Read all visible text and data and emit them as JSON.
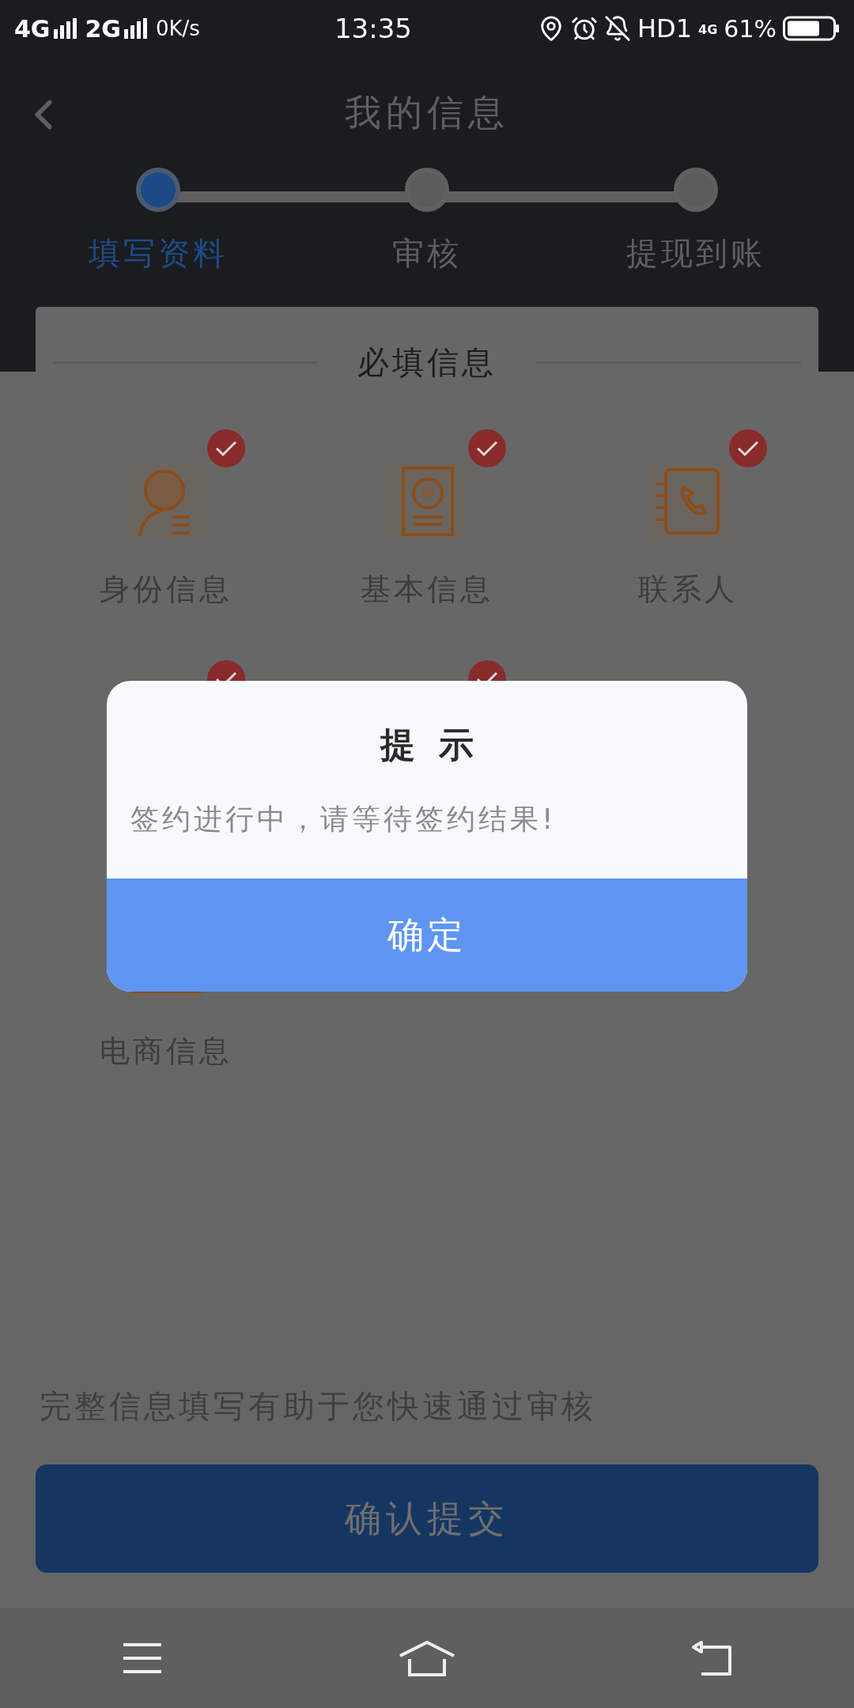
{
  "status_bar": {
    "network_1": "4G",
    "network_2": "2G",
    "speed": "0K/s",
    "time": "13:35",
    "hd": "HD1",
    "network_3": "4G",
    "battery": "61%"
  },
  "header": {
    "title": "我的信息"
  },
  "steps": [
    {
      "label": "填写资料",
      "selected": true
    },
    {
      "label": "审核",
      "selected": false
    },
    {
      "label": "提现到账",
      "selected": false
    }
  ],
  "card": {
    "title": "必填信息",
    "items": [
      {
        "kind": "person",
        "label": "身份信息",
        "checked": true
      },
      {
        "kind": "idcard",
        "label": "基本信息",
        "checked": true
      },
      {
        "kind": "phone",
        "label": "联系人",
        "checked": true
      },
      {
        "kind": "hidden",
        "checked": true
      },
      {
        "kind": "hidden",
        "checked": true
      },
      {
        "kind": "empty"
      },
      {
        "kind": "document",
        "label": "电商信息"
      }
    ]
  },
  "hint": "完整信息填写有助于您快速通过审核",
  "submit_button": "确认提交",
  "dialog": {
    "title": "提  示",
    "message": "签约进行中，请等待签约结果!",
    "confirm_button": "确定"
  }
}
